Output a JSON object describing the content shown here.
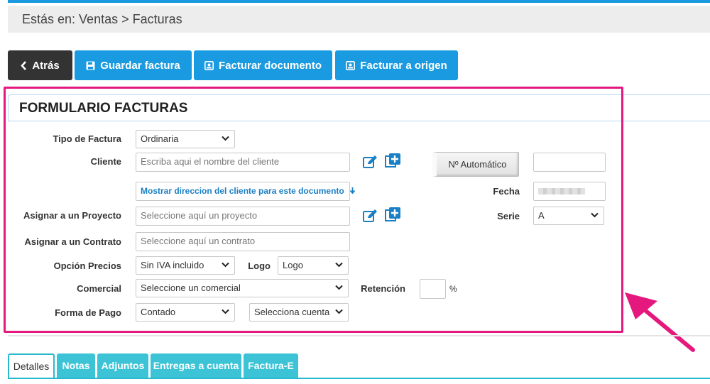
{
  "breadcrumb": "Estás en: Ventas > Facturas",
  "toolbar": {
    "back_label": "Atrás",
    "save_label": "Guardar factura",
    "invoice_doc_label": "Facturar documento",
    "invoice_origin_label": "Facturar a origen"
  },
  "form": {
    "title": "FORMULARIO FACTURAS",
    "tipo_label": "Tipo de Factura",
    "tipo_value": "Ordinaria",
    "cliente_label": "Cliente",
    "cliente_placeholder": "Escriba aqui el nombre del cliente",
    "mostrar_direccion": "Mostrar direccion del cliente para este documento",
    "proyecto_label": "Asignar a un Proyecto",
    "proyecto_placeholder": "Seleccione aquí un proyecto",
    "contrato_label": "Asignar a un Contrato",
    "contrato_placeholder": "Seleccione aquí un contrato",
    "precios_label": "Opción Precios",
    "precios_value": "Sin IVA incluido",
    "logo_label": "Logo",
    "logo_value": "Logo",
    "comercial_label": "Comercial",
    "comercial_value": "Seleccione un comercial",
    "retencion_label": "Retención",
    "retencion_unit": "%",
    "pago_label": "Forma de Pago",
    "pago_value": "Contado",
    "cuenta_value": "Selecciona cuenta",
    "auto_button": "Nº Automático",
    "fecha_label": "Fecha",
    "serie_label": "Serie",
    "serie_value": "A"
  },
  "tabs": [
    "Detalles",
    "Notas",
    "Adjuntos",
    "Entregas a cuenta",
    "Factura-E"
  ],
  "colors": {
    "accent": "#1a9ae0",
    "highlight": "#e5197d",
    "tab": "#3dc3d6"
  },
  "icons": [
    "chevron-left-icon",
    "save-icon",
    "document-icon",
    "edit-icon",
    "plus-square-icon",
    "arrow-down-icon"
  ]
}
